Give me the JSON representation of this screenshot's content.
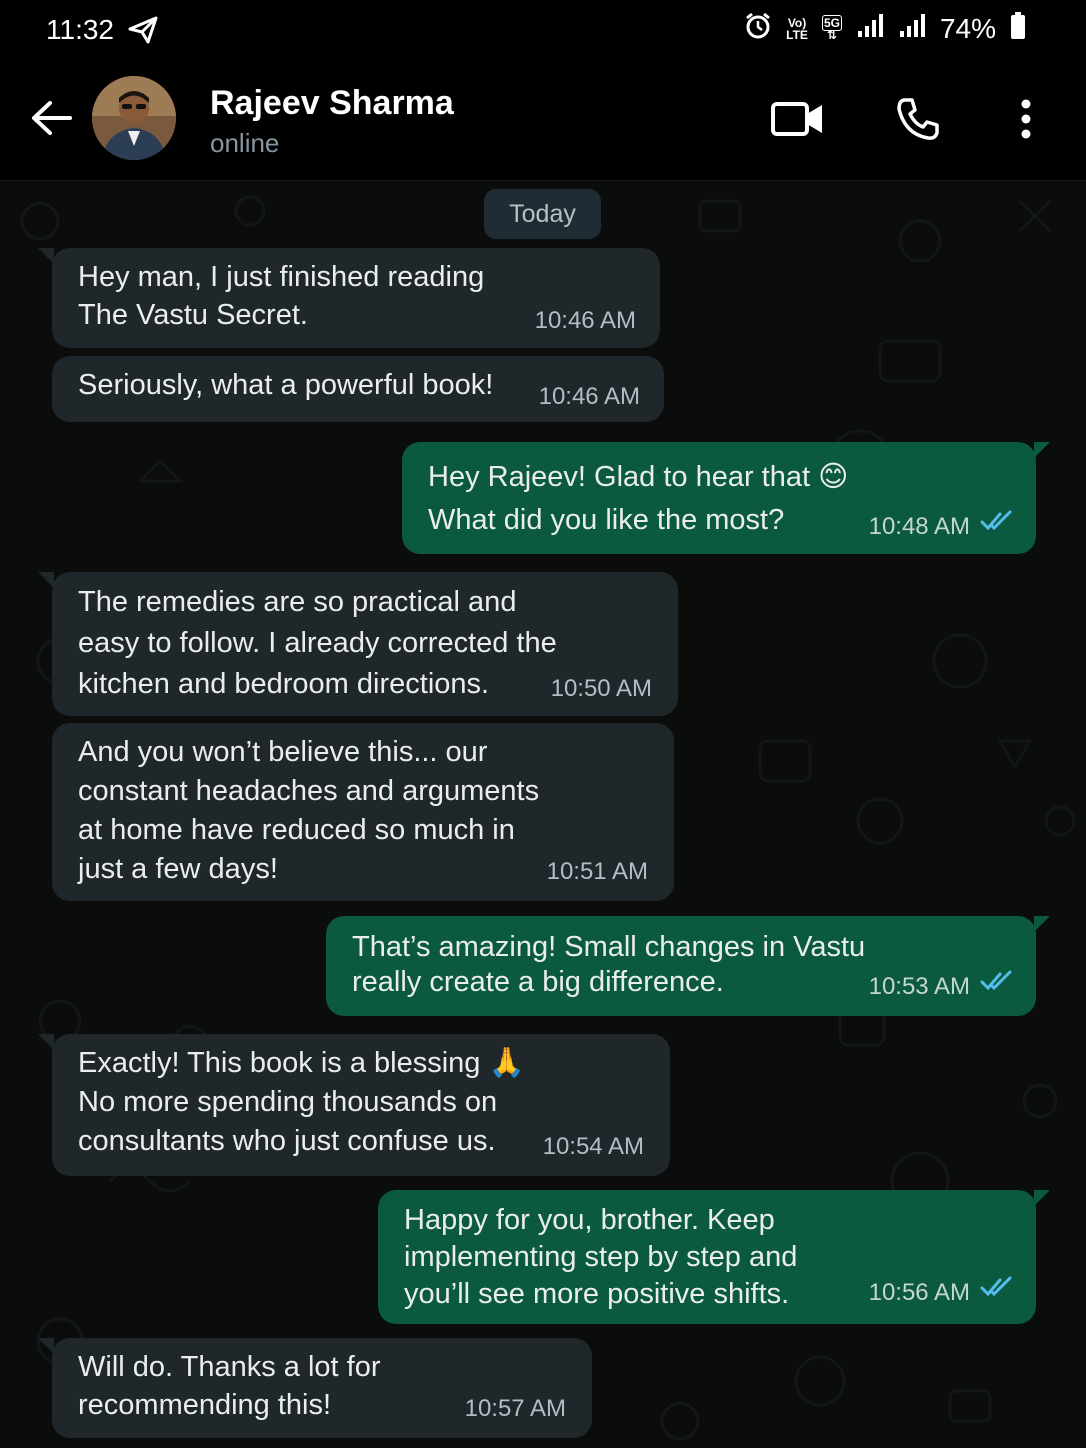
{
  "status_bar": {
    "time": "11:32",
    "volte": "Vo)",
    "lte": "LTE",
    "network": "5G",
    "battery": "74%"
  },
  "header": {
    "contact_name": "Rajeev Sharma",
    "contact_status": "online",
    "icons": [
      "back-arrow-icon",
      "video-call-icon",
      "phone-icon",
      "more-options-icon"
    ]
  },
  "chat": {
    "date_label": "Today",
    "messages": [
      {
        "direction": "in",
        "text": "Hey man, I just finished reading\nThe Vastu Secret.",
        "time": "10:46 AM"
      },
      {
        "direction": "in",
        "text": "Seriously, what a powerful book!",
        "time": "10:46 AM"
      },
      {
        "direction": "out",
        "text": "Hey Rajeev! Glad to hear that 😊\nWhat did you like the most?",
        "time": "10:48 AM",
        "status": "read"
      },
      {
        "direction": "in",
        "text": "The remedies are so practical and\neasy to follow. I already corrected the\nkitchen and bedroom directions.",
        "time": "10:50 AM"
      },
      {
        "direction": "in",
        "text": "And you won’t believe this... our\nconstant headaches and arguments\nat home have reduced so much in\njust a few days!",
        "time": "10:51 AM"
      },
      {
        "direction": "out",
        "text": "That’s amazing! Small changes in Vastu\nreally create a big difference.",
        "time": "10:53 AM",
        "status": "read"
      },
      {
        "direction": "in",
        "text": "Exactly! This book is a blessing 🙏\nNo more spending thousands on\nconsultants who just confuse us.",
        "time": "10:54 AM"
      },
      {
        "direction": "out",
        "text": "Happy for you, brother. Keep\nimplementing step by step and\nyou’ll see more positive shifts.",
        "time": "10:56 AM",
        "status": "read"
      },
      {
        "direction": "in",
        "text": "Will do. Thanks a lot for\nrecommending this!",
        "time": "10:57 AM"
      }
    ]
  },
  "colors": {
    "incoming_bubble": "#1f272a",
    "outgoing_bubble": "#0b5a3f",
    "read_ticks": "#53bdeb",
    "background": "#0b0c0c"
  }
}
